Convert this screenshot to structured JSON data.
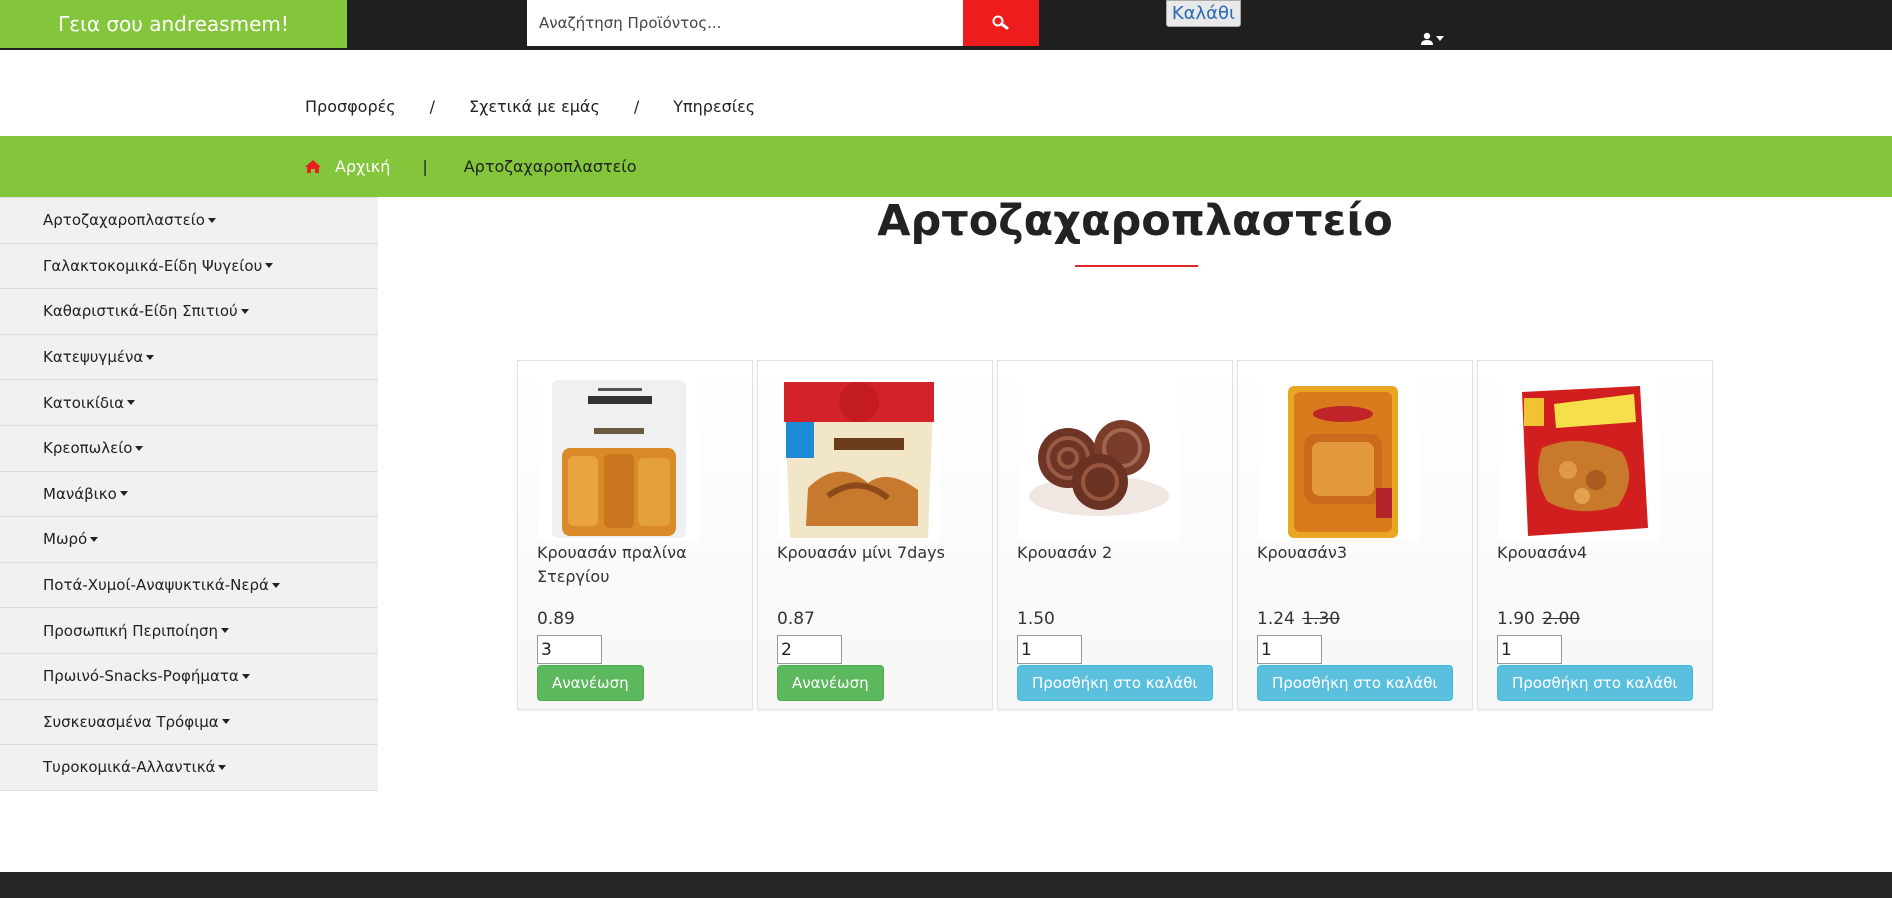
{
  "header": {
    "greeting": "Γεια σου andreasmem!",
    "search_placeholder": "Αναζήτηση Προϊόντος...",
    "cart_label": "Καλάθι"
  },
  "nav": {
    "links": [
      "Προσφορές",
      "Σχετικά με εμάς",
      "Υπηρεσίες"
    ],
    "separator": "/"
  },
  "breadcrumb": {
    "home": "Αρχική",
    "separator": "|",
    "current": "Αρτοζαχαροπλαστείο"
  },
  "sidebar": {
    "items": [
      {
        "label": "Αρτοζαχαροπλαστείο"
      },
      {
        "label": "Γαλακτοκομικά-Είδη Ψυγείου"
      },
      {
        "label": "Καθαριστικά-Είδη Σπιτιού"
      },
      {
        "label": "Κατεψυγμένα"
      },
      {
        "label": "Κατοικίδια"
      },
      {
        "label": "Κρεοπωλείο"
      },
      {
        "label": "Μανάβικο"
      },
      {
        "label": "Μωρό"
      },
      {
        "label": "Ποτά-Χυμοί-Αναψυκτικά-Νερά"
      },
      {
        "label": "Προσωπική Περιποίηση"
      },
      {
        "label": "Πρωινό-Snacks-Ροφήματα"
      },
      {
        "label": "Συσκευασμένα Τρόφιμα"
      },
      {
        "label": "Τυροκομικά-Αλλαντικά"
      }
    ]
  },
  "main": {
    "title": "Αρτοζαχαροπλαστείο",
    "products": [
      {
        "name": "Κρουασάν πραλίνα Στεργίου",
        "price": "0.89",
        "old_price": "",
        "qty": "3",
        "button": "Ανανέωση",
        "in_cart": true
      },
      {
        "name": "Κρουασάν μίνι 7days",
        "price": "0.87",
        "old_price": "",
        "qty": "2",
        "button": "Ανανέωση",
        "in_cart": true
      },
      {
        "name": "Κρουασάν 2",
        "price": "1.50",
        "old_price": "",
        "qty": "1",
        "button": "Προσθήκη στο καλάθι",
        "in_cart": false
      },
      {
        "name": "Κρουασάν3",
        "price": "1.24",
        "old_price": "1.30",
        "qty": "1",
        "button": "Προσθήκη στο καλάθι",
        "in_cart": false
      },
      {
        "name": "Κρουασάν4",
        "price": "1.90",
        "old_price": "2.00",
        "qty": "1",
        "button": "Προσθήκη στο καλάθι",
        "in_cart": false
      }
    ]
  },
  "colors": {
    "accent_green": "#84c63b",
    "search_red": "#ee1c1c",
    "btn_green": "#5cb85c",
    "btn_blue": "#5bc0de",
    "topbar": "#1f1f1f"
  }
}
